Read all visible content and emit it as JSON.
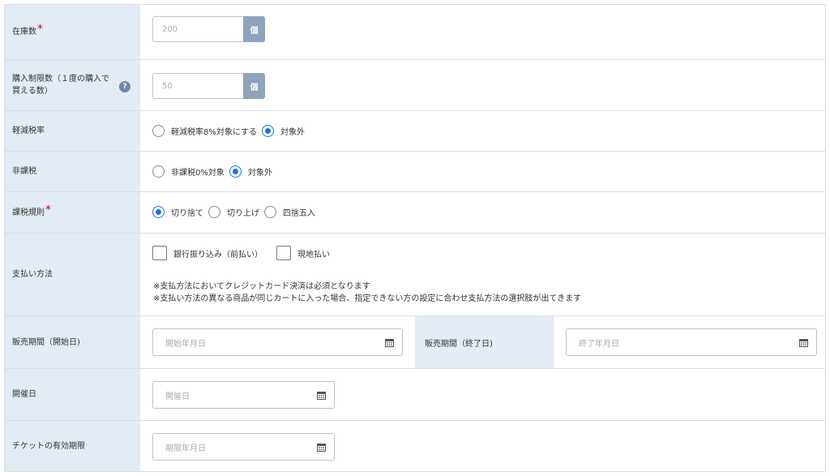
{
  "fields": {
    "stock": {
      "label": "在庫数",
      "value": "200",
      "unit": "個"
    },
    "purchase_limit": {
      "label_line1": "購入制限数（１度の購入で",
      "label_line2": "買える数）",
      "help": "?",
      "value": "50",
      "unit": "個"
    },
    "reduced_tax": {
      "label": "軽減税率",
      "options": [
        "軽減税率8%対象にする",
        "対象外"
      ],
      "selected": 1
    },
    "tax_exempt": {
      "label": "非課税",
      "options": [
        "非課税0%対象",
        "対象外"
      ],
      "selected": 1
    },
    "tax_rule": {
      "label": "課税規則",
      "options": [
        "切り捨て",
        "切り上げ",
        "四捨五入"
      ],
      "selected": 0
    },
    "payment": {
      "label": "支払い方法",
      "options": [
        "銀行振り込み（前払い）",
        "現地払い"
      ],
      "notes": [
        "※支払方法においてクレジットカード決済は必須となります",
        "※支払い方法の異なる商品が同じカートに入った場合、指定できない方の設定に合わせ支払方法の選択肢が出てきます"
      ]
    },
    "sale_period": {
      "label_start": "販売期間（開始日)",
      "placeholder_start": "開始年月日",
      "label_end": "販売期間（終了日)",
      "placeholder_end": "終了年月日"
    },
    "event_date": {
      "label": "開催日",
      "placeholder": "開催日"
    },
    "ticket_expiry": {
      "label": "チケットの有効期限",
      "placeholder": "期限年月日"
    }
  },
  "required_mark": "*",
  "colors": {
    "label_bg": "#e3ebf4",
    "accent": "#1a73e8",
    "unit_bg": "#8ea3bd",
    "required": "#d0021b"
  }
}
